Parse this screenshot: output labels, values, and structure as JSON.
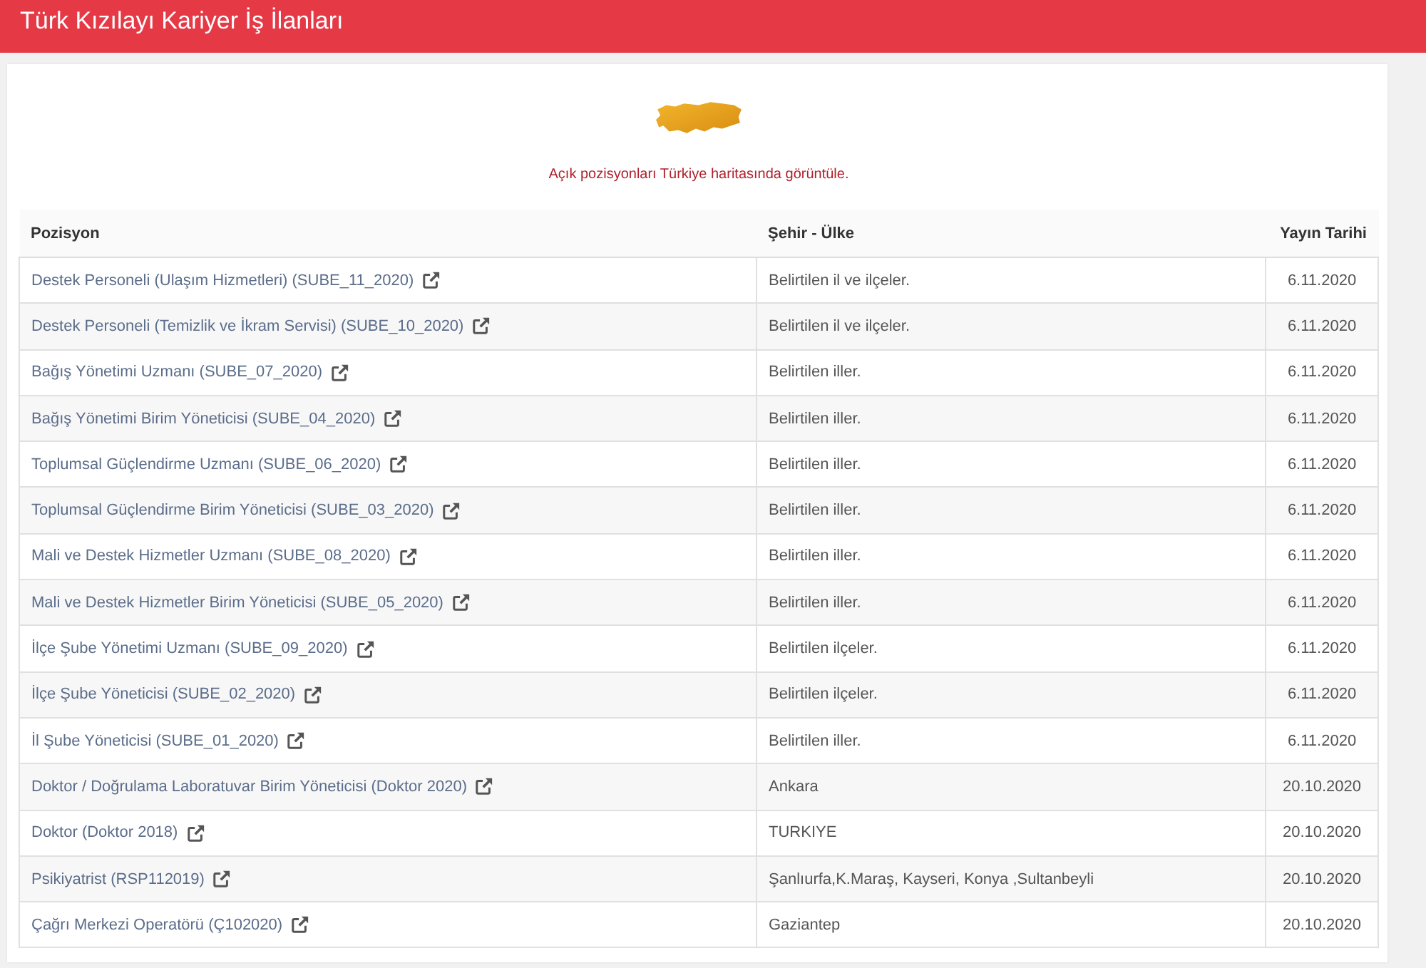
{
  "header": {
    "title": "Türk Kızılayı Kariyer İş İlanları"
  },
  "map_link": {
    "label": "Açık pozisyonları Türkiye haritasında görüntüle."
  },
  "table": {
    "columns": [
      "Pozisyon",
      "Şehir - Ülke",
      "Yayın Tarihi"
    ],
    "rows": [
      {
        "position": "Destek Personeli (Ulaşım Hizmetleri) (SUBE_11_2020)",
        "location": "Belirtilen il ve ilçeler.",
        "date": "6.11.2020"
      },
      {
        "position": "Destek Personeli (Temizlik ve İkram Servisi) (SUBE_10_2020)",
        "location": "Belirtilen il ve ilçeler.",
        "date": "6.11.2020"
      },
      {
        "position": "Bağış Yönetimi Uzmanı (SUBE_07_2020)",
        "location": "Belirtilen iller.",
        "date": "6.11.2020"
      },
      {
        "position": "Bağış Yönetimi Birim Yöneticisi (SUBE_04_2020)",
        "location": "Belirtilen iller.",
        "date": "6.11.2020"
      },
      {
        "position": "Toplumsal Güçlendirme Uzmanı (SUBE_06_2020)",
        "location": "Belirtilen iller.",
        "date": "6.11.2020"
      },
      {
        "position": "Toplumsal Güçlendirme Birim Yöneticisi (SUBE_03_2020)",
        "location": "Belirtilen iller.",
        "date": "6.11.2020"
      },
      {
        "position": "Mali ve Destek Hizmetler Uzmanı (SUBE_08_2020)",
        "location": "Belirtilen iller.",
        "date": "6.11.2020"
      },
      {
        "position": "Mali ve Destek Hizmetler Birim Yöneticisi (SUBE_05_2020)",
        "location": "Belirtilen iller.",
        "date": "6.11.2020"
      },
      {
        "position": "İlçe Şube Yönetimi Uzmanı (SUBE_09_2020)",
        "location": "Belirtilen ilçeler.",
        "date": "6.11.2020"
      },
      {
        "position": "İlçe Şube Yöneticisi (SUBE_02_2020)",
        "location": "Belirtilen ilçeler.",
        "date": "6.11.2020"
      },
      {
        "position": "İl Şube Yöneticisi (SUBE_01_2020)",
        "location": "Belirtilen iller.",
        "date": "6.11.2020"
      },
      {
        "position": "Doktor / Doğrulama Laboratuvar Birim Yöneticisi (Doktor 2020)",
        "location": "Ankara",
        "date": "20.10.2020"
      },
      {
        "position": "Doktor (Doktor 2018)",
        "location": "TURKIYE",
        "date": "20.10.2020"
      },
      {
        "position": "Psikiyatrist (RSP112019)",
        "location": "Şanlıurfa,K.Maraş, Kayseri, Konya ,Sultanbeyli",
        "date": "20.10.2020"
      },
      {
        "position": "Çağrı Merkezi Operatörü (Ç102020)",
        "location": "Gaziantep",
        "date": "20.10.2020"
      }
    ]
  }
}
